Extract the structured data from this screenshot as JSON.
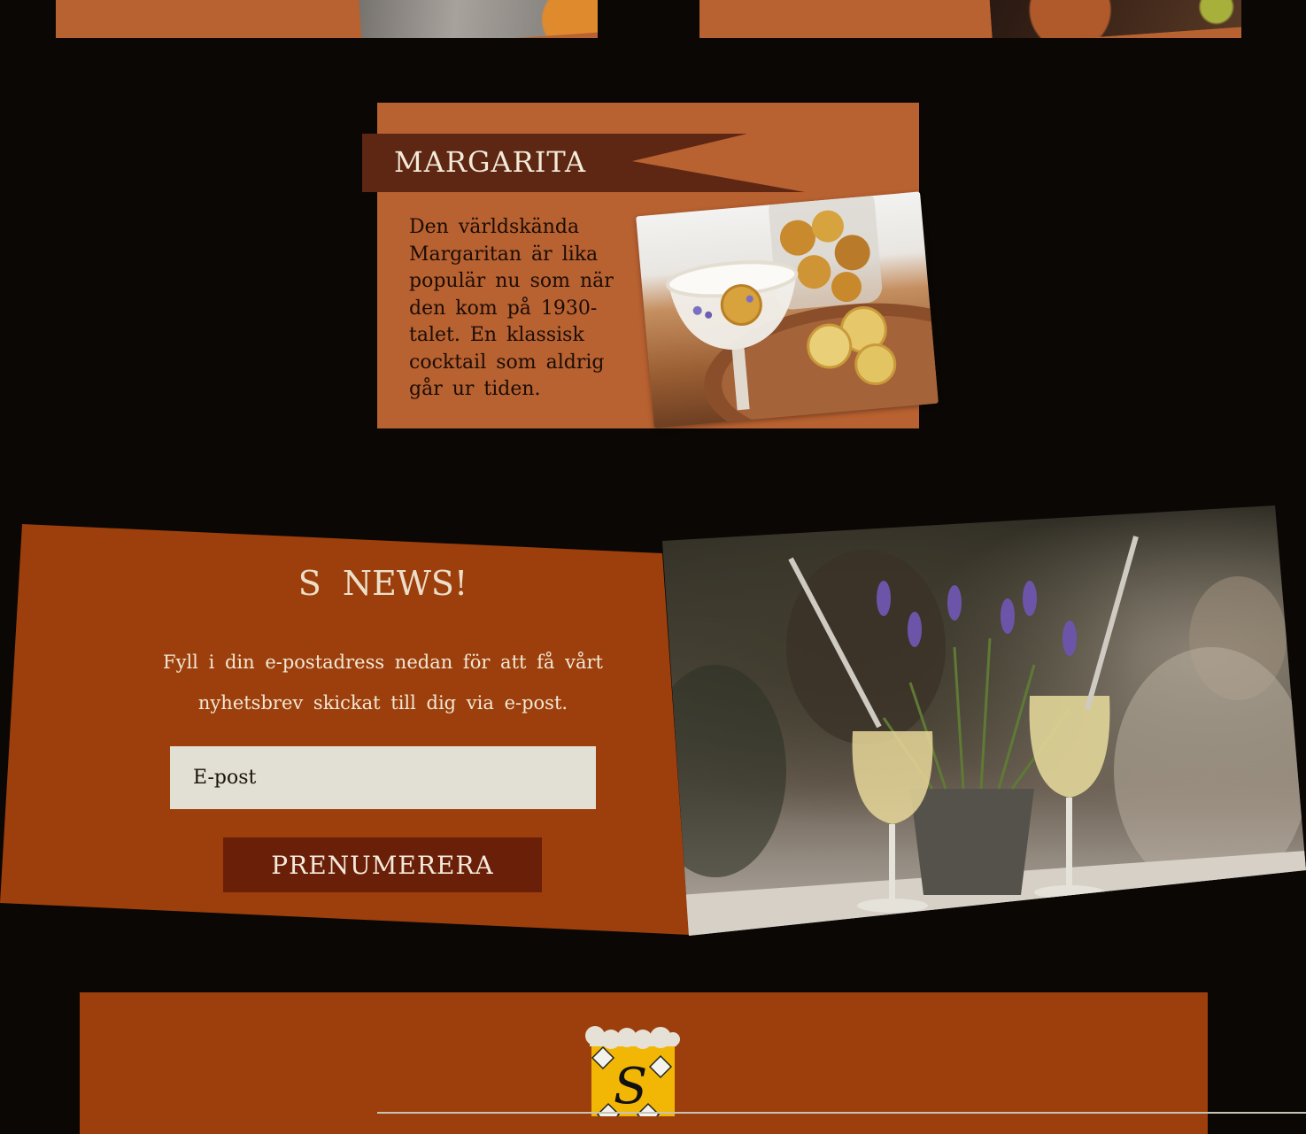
{
  "margarita": {
    "title": "MARGARITA",
    "description": "Den världskända Margaritan är lika populär nu som när den kom på 1930-talet. En klassisk cocktail som aldrig går ur tiden."
  },
  "newsletter": {
    "title": "S  NEWS!",
    "text": "Fyll i din e-postadress nedan för att få vårt nyhetsbrev skickat till dig via e-post.",
    "email_placeholder": "E-post",
    "subscribe_label": "PRENUMERERA"
  },
  "footer": {
    "logo_letter": "S"
  },
  "colors": {
    "background": "#0b0705",
    "card": "#b86131",
    "ribbon": "#5e2714",
    "panel": "#9c3f0c",
    "button": "#6a1f08",
    "input": "#e2e0d5",
    "logo_yellow": "#f2b705"
  }
}
